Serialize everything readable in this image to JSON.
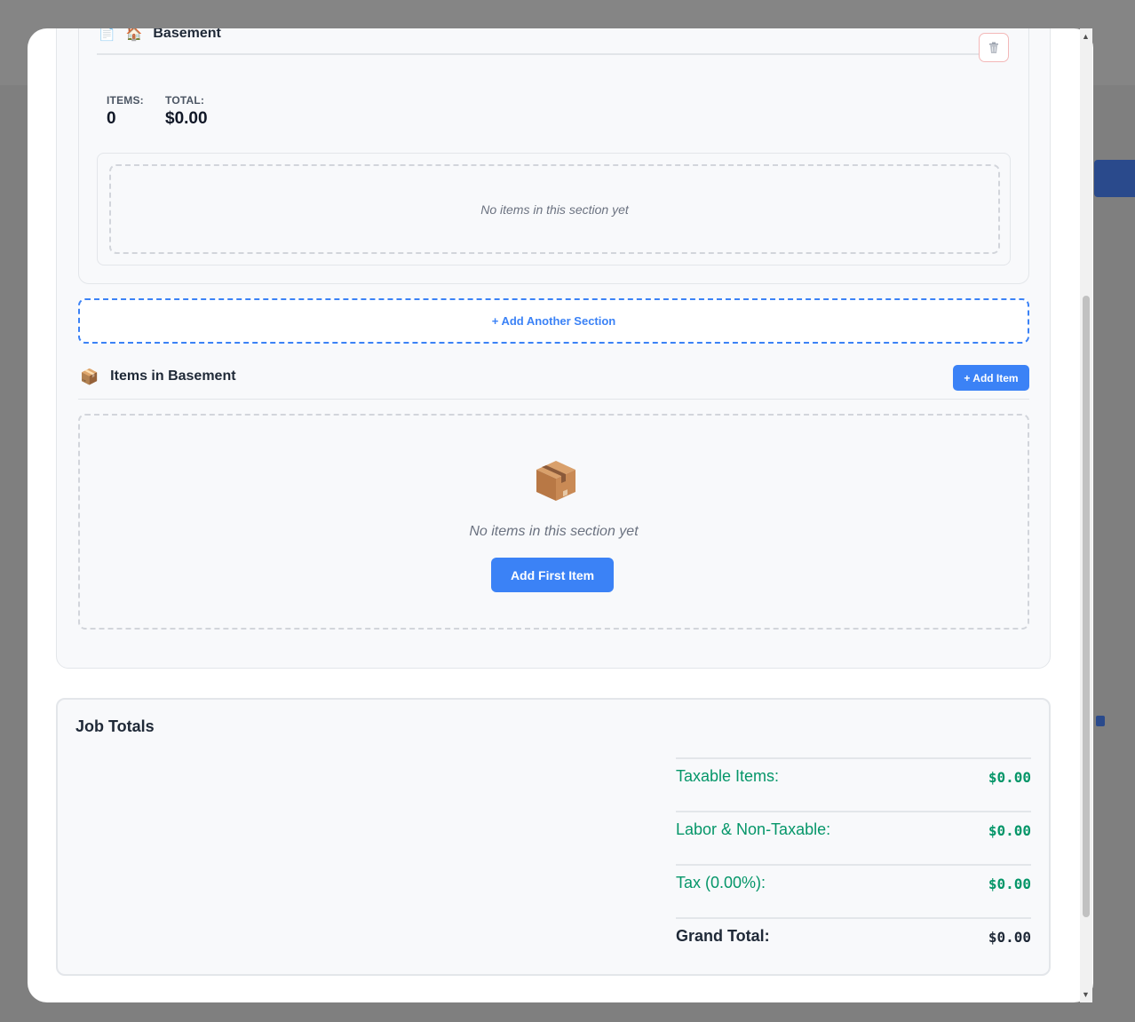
{
  "section": {
    "title": "Basement",
    "title_emoji": "🏠",
    "list_emoji": "📄",
    "trash_icon": "trash-icon",
    "items_label": "ITEMS:",
    "items_value": "0",
    "total_label": "TOTAL:",
    "total_value": "$0.00",
    "empty_text": "No items in this section yet"
  },
  "add_section_label": "+ Add Another Section",
  "items_panel": {
    "emoji": "📦",
    "title": "Items in Basement",
    "add_item_label": "+ Add Item",
    "empty_text": "No items in this section yet",
    "add_first_label": "Add First Item"
  },
  "totals": {
    "title": "Job Totals",
    "rows": [
      {
        "label": "Taxable Items:",
        "value": "$0.00"
      },
      {
        "label": "Labor & Non-Taxable:",
        "value": "$0.00"
      },
      {
        "label": "Tax (0.00%):",
        "value": "$0.00"
      },
      {
        "label": "Grand Total:",
        "value": "$0.00"
      }
    ]
  },
  "colors": {
    "accent": "#3b82f6",
    "success": "#059669",
    "danger_border": "#f3b8b8"
  }
}
